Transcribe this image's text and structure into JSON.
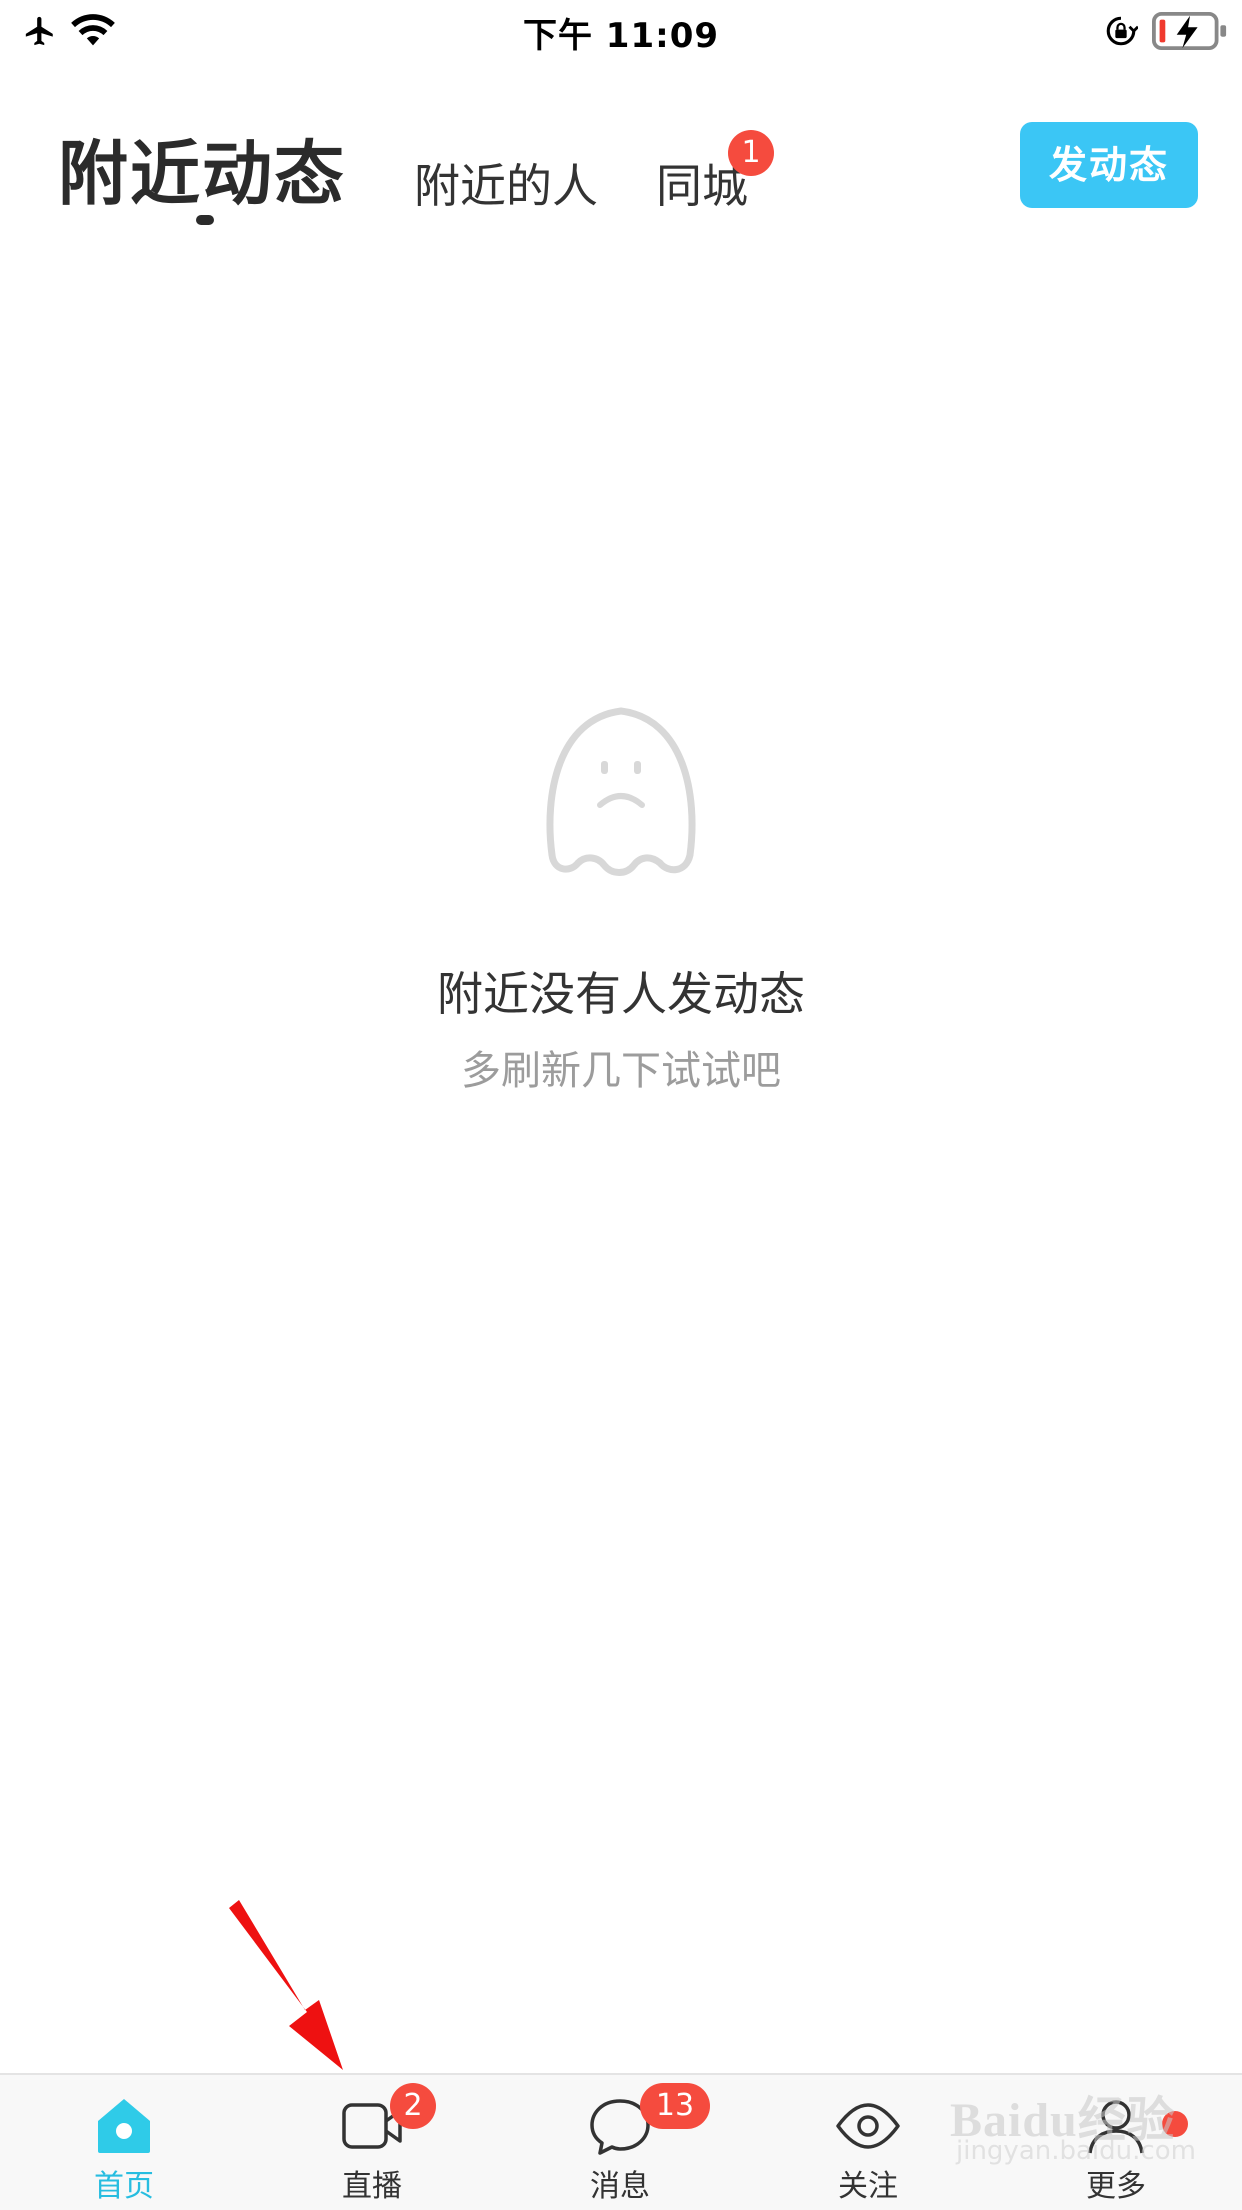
{
  "status_bar": {
    "time": "下午 11:09",
    "icons": [
      "airplane-icon",
      "wifi-icon",
      "rotation-lock-icon",
      "battery-charging-icon"
    ]
  },
  "header": {
    "tabs": [
      {
        "label": "附近动态",
        "active": true
      },
      {
        "label": "附近的人",
        "active": false
      },
      {
        "label": "同城",
        "active": false,
        "badge": "1"
      }
    ],
    "post_button": "发动态"
  },
  "empty_state": {
    "icon": "sad-ghost-icon",
    "title": "附近没有人发动态",
    "subtitle": "多刷新几下试试吧"
  },
  "bottom_nav": {
    "items": [
      {
        "label": "首页",
        "icon": "home-icon",
        "active": true
      },
      {
        "label": "直播",
        "icon": "video-camera-icon",
        "badge": "2"
      },
      {
        "label": "消息",
        "icon": "chat-bubble-icon",
        "badge": "13"
      },
      {
        "label": "关注",
        "icon": "eye-icon"
      },
      {
        "label": "更多",
        "icon": "person-icon",
        "dot": true
      }
    ]
  },
  "watermark": {
    "text": "Baidu经验",
    "sub": "jingyan.baidu.com"
  },
  "colors": {
    "accent": "#27bde0",
    "post_button": "#3bc6f5",
    "badge": "#f54b3e",
    "annotation_arrow": "#ee1111"
  }
}
